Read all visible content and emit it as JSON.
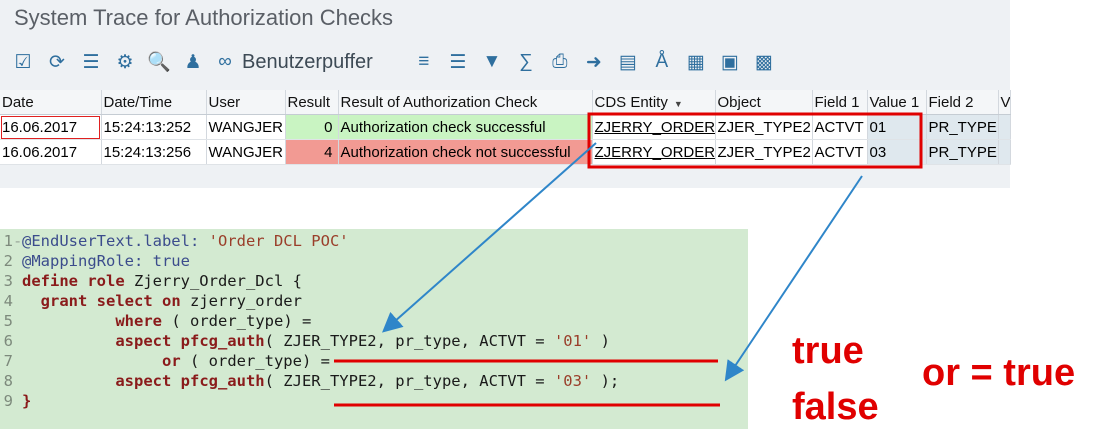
{
  "window": {
    "title": "System Trace for Authorization Checks"
  },
  "toolbar": {
    "buffer_label": "Benutzerpuffer"
  },
  "table": {
    "columns": [
      "Date",
      "Date/Time",
      "User",
      "Result",
      "Result of Authorization Check",
      "CDS Entity",
      "Object",
      "Field 1",
      "Value 1",
      "Field 2",
      "V"
    ],
    "rows": [
      {
        "date": "16.06.2017",
        "time": "15:24:13:252",
        "user": "WANGJER",
        "result": "0",
        "result_text": "Authorization check successful",
        "cds": "ZJERRY_ORDER",
        "object": "ZJER_TYPE2",
        "field1": "ACTVT",
        "value1": "01",
        "field2": "PR_TYPE"
      },
      {
        "date": "16.06.2017",
        "time": "15:24:13:256",
        "user": "WANGJER",
        "result": "4",
        "result_text": "Authorization check not successful",
        "cds": "ZJERRY_ORDER",
        "object": "ZJER_TYPE2",
        "field1": "ACTVT",
        "value1": "03",
        "field2": "PR_TYPE"
      }
    ]
  },
  "code": {
    "line_numbers": [
      "1",
      "2",
      "3",
      "4",
      "5",
      "6",
      "7",
      "8",
      "9"
    ],
    "l1_annotation": "@EndUserText.label: ",
    "l1_string": "'Order DCL POC'",
    "l2_annotation": "@MappingRole: true",
    "l3_kw": "define role",
    "l3_rest": " Zjerry_Order_Dcl {",
    "l4_kw1": "grant select on",
    "l4_rest": " zjerry_order",
    "l5_kw": "where",
    "l5_rest": " ( order_type) =",
    "l6_kw": "aspect pfcg_auth",
    "l6_rest": "( ZJER_TYPE2, pr_type, ACTVT = ",
    "l6_str": "'01'",
    "l6_end": " )",
    "l7_kw": "or",
    "l7_rest": " ( order_type) =",
    "l8_kw": "aspect pfcg_auth",
    "l8_rest": "( ZJER_TYPE2, pr_type, ACTVT = ",
    "l8_str": "'03'",
    "l8_end": " );",
    "l9": "}"
  },
  "annotations": {
    "true_label": "true",
    "false_label": "false",
    "or_label": "or = true"
  },
  "colors": {
    "success": "#c9f4c2",
    "failure": "#f29a93",
    "code_bg": "#d3ead1",
    "annotation_red": "#e00000",
    "arrow_blue": "#2f86c9"
  }
}
